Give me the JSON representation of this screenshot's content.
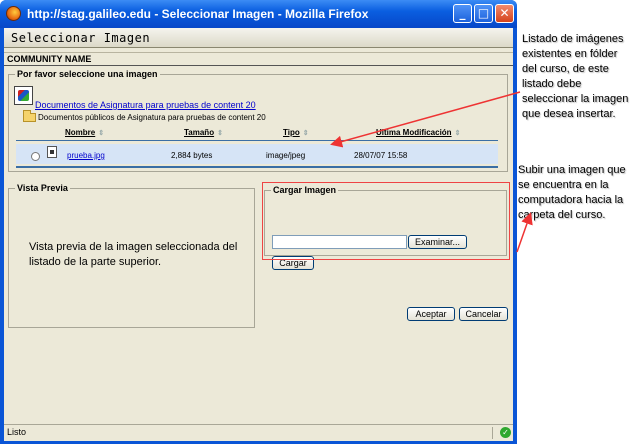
{
  "window": {
    "title": "http://stag.galileo.edu - Seleccionar Imagen - Mozilla Firefox",
    "minimize_glyph": "_",
    "maximize_glyph": "□",
    "close_glyph": "✕"
  },
  "page": {
    "header_title": "Seleccionar Imagen",
    "community": "COMMUNITY NAME"
  },
  "select_section": {
    "legend": "Por favor seleccione una imagen",
    "course_link": "Documentos de Asignatura para pruebas de content 20",
    "folder_label": "Documentos públicos de Asignatura para pruebas de content 20",
    "columns": [
      "Nombre",
      "Tamaño",
      "Tipo",
      "Ultima Modificación"
    ],
    "rows": [
      {
        "name": "prueba.jpg",
        "size": "2,884 bytes",
        "type": "image/jpeg",
        "modified": "28/07/07 15:58"
      }
    ]
  },
  "preview": {
    "legend": "Vista Previa",
    "text": "Vista previa de la imagen seleccionada del listado de la parte superior."
  },
  "upload": {
    "legend": "Cargar Imagen",
    "browse_label": "Examinar...",
    "upload_label": "Cargar"
  },
  "actions": {
    "accept_label": "Aceptar",
    "cancel_label": "Cancelar"
  },
  "status": {
    "text": "Listo"
  },
  "annotations": {
    "listing": "Listado de imágenes existentes en fólder del curso, de este listado debe seleccionar la imagen que desea insertar.",
    "upload": "Subir una imagen que se encuentra en la computadora hacia la carpeta del curso."
  },
  "colors": {
    "titlebar": "#0a5ee0",
    "client_bg": "#ece9d8",
    "row_highlight": "#d6e4f6",
    "annotation_red": "#ee4444",
    "link": "#0000cc"
  }
}
